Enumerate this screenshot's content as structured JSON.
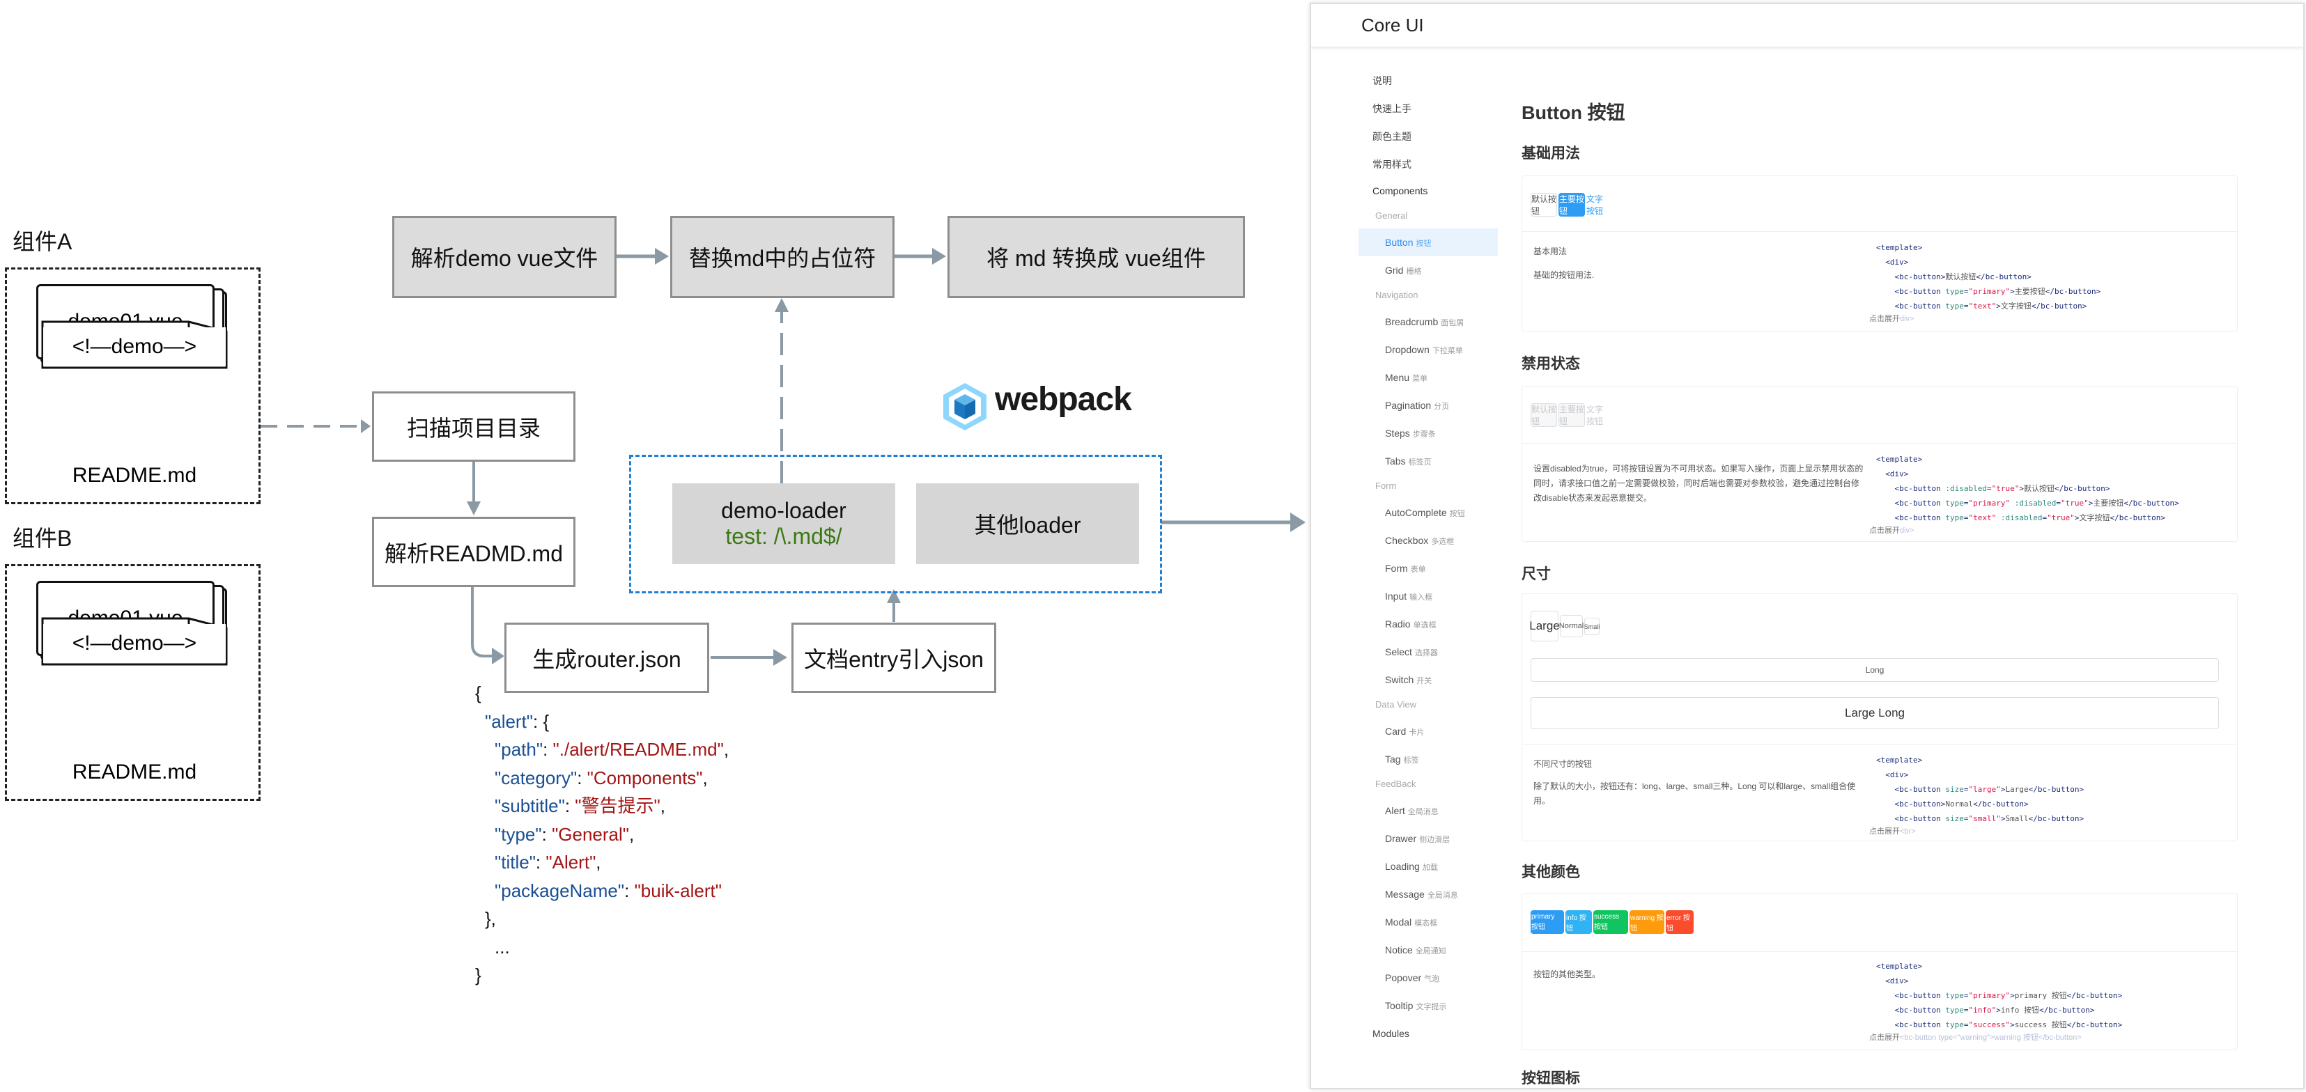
{
  "diagram": {
    "groups": [
      {
        "label": "组件A",
        "vue_file": "demo01.vue",
        "md_content": "<!—demo—>",
        "md_name": "README.md"
      },
      {
        "label": "组件B",
        "vue_file": "demo01.vue",
        "md_content": "<!—demo—>",
        "md_name": "README.md"
      }
    ],
    "steps": {
      "parse_demo": "解析demo vue文件",
      "replace_placeholder": "替换md中的占位符",
      "md_to_vue": "将 md 转换成 vue组件",
      "scan_dir": "扫描项目目录",
      "parse_readme": "解析READMD.md",
      "gen_router": "生成router.json",
      "doc_entry": "文档entry引入json"
    },
    "webpack": {
      "logo_text": "webpack",
      "demo_loader": "demo-loader",
      "demo_loader_test": "test: /\\.md$/",
      "other_loader": "其他loader"
    },
    "json_sample": {
      "open": "{",
      "key": "\"alert\"",
      "colon_open": ": {",
      "fields": [
        {
          "key": "\"path\"",
          "value": "\"./alert/README.md\"",
          "comma": ","
        },
        {
          "key": "\"category\"",
          "value": "\"Components\"",
          "comma": ","
        },
        {
          "key": "\"subtitle\"",
          "value": "\"警告提示\"",
          "comma": ","
        },
        {
          "key": "\"type\"",
          "value": "\"General\"",
          "comma": ","
        },
        {
          "key": "\"title\"",
          "value": "\"Alert\"",
          "comma": ","
        },
        {
          "key": "\"packageName\"",
          "value": "\"buik-alert\"",
          "comma": ""
        }
      ],
      "close_inner": "},",
      "ellipsis": "...",
      "close": "}"
    },
    "colors": {
      "arrow": "#8a99a3",
      "loader_border": "#1f7fd6",
      "gray_box": "#dcdcdc"
    }
  },
  "doc": {
    "app_title": "Core UI",
    "sidebar": {
      "top_items": [
        "说明",
        "快速上手",
        "颜色主题",
        "常用样式",
        "Components"
      ],
      "sections": [
        {
          "title": "General",
          "items": [
            {
              "en": "Button",
              "zh": "按钮",
              "active": true
            },
            {
              "en": "Grid",
              "zh": "栅格"
            }
          ]
        },
        {
          "title": "Navigation",
          "items": [
            {
              "en": "Breadcrumb",
              "zh": "面包屑"
            },
            {
              "en": "Dropdown",
              "zh": "下拉菜单"
            },
            {
              "en": "Menu",
              "zh": "菜单"
            },
            {
              "en": "Pagination",
              "zh": "分页"
            },
            {
              "en": "Steps",
              "zh": "步骤条"
            },
            {
              "en": "Tabs",
              "zh": "标签页"
            }
          ]
        },
        {
          "title": "Form",
          "items": [
            {
              "en": "AutoComplete",
              "zh": "按钮"
            },
            {
              "en": "Checkbox",
              "zh": "多选框"
            },
            {
              "en": "Form",
              "zh": "表单"
            },
            {
              "en": "Input",
              "zh": "输入框"
            },
            {
              "en": "Radio",
              "zh": "单选框"
            },
            {
              "en": "Select",
              "zh": "选择器"
            },
            {
              "en": "Switch",
              "zh": "开关"
            }
          ]
        },
        {
          "title": "Data View",
          "items": [
            {
              "en": "Card",
              "zh": "卡片"
            },
            {
              "en": "Tag",
              "zh": "标签"
            }
          ]
        },
        {
          "title": "FeedBack",
          "items": [
            {
              "en": "Alert",
              "zh": "全局消息"
            },
            {
              "en": "Drawer",
              "zh": "侧边滑层"
            },
            {
              "en": "Loading",
              "zh": "加载"
            },
            {
              "en": "Message",
              "zh": "全局消息"
            },
            {
              "en": "Modal",
              "zh": "模态框"
            },
            {
              "en": "Notice",
              "zh": "全局通知"
            },
            {
              "en": "Popover",
              "zh": "气泡"
            },
            {
              "en": "Tooltip",
              "zh": "文字提示"
            }
          ]
        }
      ],
      "bottom_item": "Modules"
    },
    "page_title": "Button 按钮",
    "sections": {
      "basic": {
        "title": "基础用法",
        "buttons": {
          "default": "默认按钮",
          "primary": "主要按钮",
          "text": "文字按钮"
        },
        "desc_title": "基本用法",
        "desc": "基础的按钮用法.",
        "code": [
          "<template>",
          "  <div>",
          "    <bc-button>默认按钮</bc-button>",
          "    <bc-button type=\"primary\">主要按钮</bc-button>",
          "    <bc-button type=\"text\">文字按钮</bc-button>"
        ],
        "expand": "点击展开",
        "expand_tail": "div>"
      },
      "disabled": {
        "title": "禁用状态",
        "buttons": {
          "default": "默认按钮",
          "primary": "主要按钮",
          "text": "文字按钮"
        },
        "desc": "设置disabled为true，可将按钮设置为不可用状态。如果写入操作，页面上显示禁用状态的同时，请求接口值之前一定需要做校验，同时后端也需要对参数校验，避免通过控制台修改disable状态来发起恶意提交。",
        "code": [
          "<template>",
          "  <div>",
          "    <bc-button :disabled=\"true\">默认按钮</bc-button>",
          "    <bc-button type=\"primary\" :disabled=\"true\">主要按钮</bc-button>",
          "    <bc-button type=\"text\" :disabled=\"true\">文字按钮</bc-button>"
        ],
        "expand": "点击展开",
        "expand_tail": "div>"
      },
      "size": {
        "title": "尺寸",
        "buttons": {
          "large": "Large",
          "normal": "Normal",
          "small": "Small",
          "long": "Long",
          "large_long": "Large Long"
        },
        "desc_title": "不同尺寸的按钮",
        "desc": "除了默认的大小，按钮还有：long、large、small三种。Long 可以和large、small组合使用。",
        "code": [
          "<template>",
          "  <div>",
          "    <bc-button size=\"large\">Large</bc-button>",
          "    <bc-button>Normal</bc-button>",
          "    <bc-button size=\"small\">Small</bc-button>"
        ],
        "expand": "点击展开",
        "expand_tail": "<br>"
      },
      "colors": {
        "title": "其他颜色",
        "buttons": [
          {
            "label": "primary 按钮",
            "color": "#2d9cf5"
          },
          {
            "label": "info 按钮",
            "color": "#2fb3f4"
          },
          {
            "label": "success 按钮",
            "color": "#10c55f"
          },
          {
            "label": "warning 按钮",
            "color": "#fd9b0c"
          },
          {
            "label": "error 按钮",
            "color": "#fb4c2d"
          }
        ],
        "desc": "按钮的其他类型。",
        "code": [
          "<template>",
          "  <div>",
          "    <bc-button type=\"primary\">primary 按钮</bc-button>",
          "    <bc-button type=\"info\">info 按钮</bc-button>",
          "    <bc-button type=\"success\">success 按钮</bc-button>"
        ],
        "expand": "点击展开",
        "expand_tail": "<bc-button type=\"warning\">warning 按钮</bc-button>"
      },
      "icon": {
        "title": "按钮图标"
      }
    }
  }
}
